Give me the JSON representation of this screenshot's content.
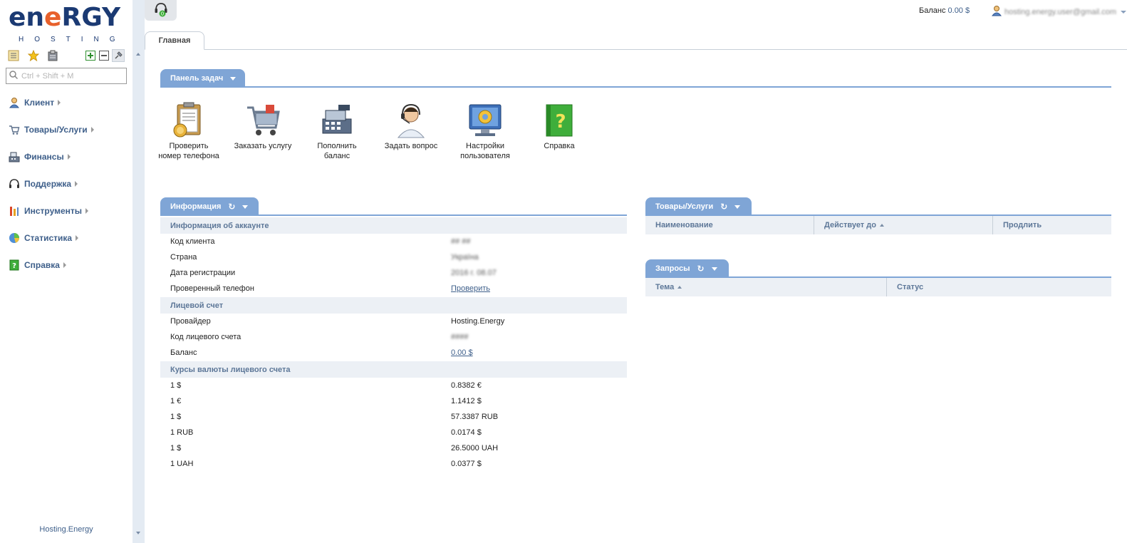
{
  "logo": {
    "word_pre": "en",
    "word_o": "e",
    "word_post": "RGY",
    "sub": "HOSTING"
  },
  "sidebar": {
    "search_placeholder": "Ctrl + Shift + M",
    "items": [
      {
        "label": "Клиент",
        "icon": "client-icon"
      },
      {
        "label": "Товары/Услуги",
        "icon": "cart-icon"
      },
      {
        "label": "Финансы",
        "icon": "finance-icon"
      },
      {
        "label": "Поддержка",
        "icon": "headset-icon"
      },
      {
        "label": "Инструменты",
        "icon": "tools-icon"
      },
      {
        "label": "Статистика",
        "icon": "pie-chart-icon"
      },
      {
        "label": "Справка",
        "icon": "help-book-icon"
      }
    ],
    "footer": "Hosting.Energy"
  },
  "header": {
    "notifications_count": "0",
    "balance_label": "Баланс",
    "balance_value": "0.00 $",
    "user_email": "hosting.energy.user@gmail.com"
  },
  "tabs": [
    {
      "label": "Главная"
    }
  ],
  "taskbar": {
    "title": "Панель задач",
    "tasks": [
      {
        "label": "Проверить номер телефона",
        "icon": "verify-phone-icon"
      },
      {
        "label": "Заказать услугу",
        "icon": "order-cart-icon"
      },
      {
        "label": "Пополнить баланс",
        "icon": "cash-register-icon"
      },
      {
        "label": "Задать вопрос",
        "icon": "support-agent-icon"
      },
      {
        "label": "Настройки пользователя",
        "icon": "settings-monitor-icon"
      },
      {
        "label": "Справка",
        "icon": "help-book-icon"
      }
    ]
  },
  "info": {
    "title": "Информация",
    "account_section": "Информация об аккаунте",
    "client_code_label": "Код клиента",
    "client_code_value": "## ##",
    "country_label": "Страна",
    "country_value": "Україна",
    "reg_date_label": "Дата регистрации",
    "reg_date_value": "2016 г. 08.07",
    "phone_label": "Проверенный телефон",
    "phone_value": "Проверить",
    "account_section2": "Лицевой счет",
    "provider_label": "Провайдер",
    "provider_value": "Hosting.Energy",
    "account_code_label": "Код лицевого счета",
    "account_code_value": "####",
    "balance_label": "Баланс",
    "balance_value": "0.00 $",
    "rates_section": "Курсы валюты лицевого счета",
    "rates": [
      {
        "from": "1 $",
        "to": "0.8382 €"
      },
      {
        "from": "1 €",
        "to": "1.1412 $"
      },
      {
        "from": "1 $",
        "to": "57.3387 RUB"
      },
      {
        "from": "1 RUB",
        "to": "0.0174 $"
      },
      {
        "from": "1 $",
        "to": "26.5000 UAH"
      },
      {
        "from": "1 UAH",
        "to": "0.0377 $"
      }
    ]
  },
  "services": {
    "title": "Товары/Услуги",
    "columns": [
      "Наименование",
      "Действует до",
      "Продлить"
    ]
  },
  "requests": {
    "title": "Запросы",
    "columns": [
      "Тема",
      "Статус"
    ]
  },
  "colors": {
    "accent": "#7fa5d6",
    "nav_text": "#3e5f8a",
    "section_bg": "#ecf0f5",
    "logo_blue": "#1b3a73",
    "logo_orange": "#e8612c"
  }
}
